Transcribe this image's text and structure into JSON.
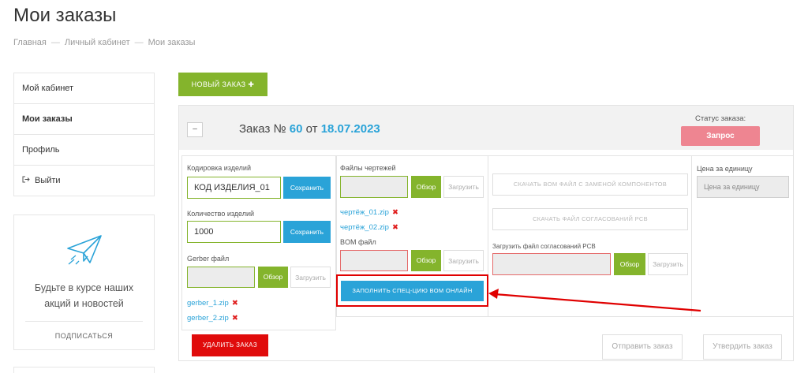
{
  "page": {
    "title": "Мои заказы",
    "breadcrumb": [
      "Главная",
      "Личный кабинет",
      "Мои заказы"
    ],
    "breadcrumb_sep": "—"
  },
  "sidebar": {
    "items": [
      {
        "label": "Мой кабинет",
        "active": false
      },
      {
        "label": "Мои заказы",
        "active": true
      },
      {
        "label": "Профиль",
        "active": false
      },
      {
        "label": "Выйти",
        "active": false,
        "icon": "logout-icon"
      }
    ],
    "subscribe": {
      "icon": "paper-plane-icon",
      "text_line1": "Будьте в курсе наших",
      "text_line2": "акций и новостей",
      "link": "ПОДПИСАТЬСЯ"
    }
  },
  "new_order_button": "НОВЫЙ ЗАКАЗ ✚",
  "order": {
    "collapse": "–",
    "title_prefix": "Заказ №",
    "number": "60",
    "title_mid": "от",
    "date": "18.07.2023",
    "status_label": "Статус заказа:",
    "status": "Запрос",
    "product_code_label": "Кодировка изделий",
    "product_code_value": "КОД ИЗДЕЛИЯ_01",
    "save_label": "Сохранить",
    "quantity_label": "Количество изделий",
    "quantity_value": "1000",
    "gerber_label": "Gerber файл",
    "browse_label": "Обзор",
    "upload_label": "Загрузить",
    "gerber_files": [
      "gerber_1.zip",
      "gerber_2.zip"
    ],
    "drawings_label": "Файлы чертежей",
    "drawing_files": [
      "чертёж_01.zip",
      "чертёж_02.zip"
    ],
    "bom_label": "BOM файл",
    "fill_bom_button": "ЗАПОЛНИТЬ СПЕЦ-ЦИЮ BOM ОНЛАЙН",
    "download_bom_button": "СКАЧАТЬ BOM ФАЙЛ С ЗАМЕНОЙ КОМПОНЕНТОВ",
    "download_pcb_button": "СКАЧАТЬ ФАЙЛ СОГЛАСОВАНИЙ PCB",
    "upload_pcb_label": "Загрузить файл согласований PCB",
    "unit_price_label": "Цена за единицу",
    "unit_price_placeholder": "Цена за единицу",
    "remove_mark": "✖",
    "delete_button": "УДАЛИТЬ ЗАКАЗ",
    "send_button": "Отправить заказ",
    "approve_button": "Утвердить заказ"
  },
  "colors": {
    "accent_blue": "#2aa3d8",
    "green": "#84b42c",
    "status_pink": "#ee8591",
    "danger_red": "#e00b0b"
  }
}
